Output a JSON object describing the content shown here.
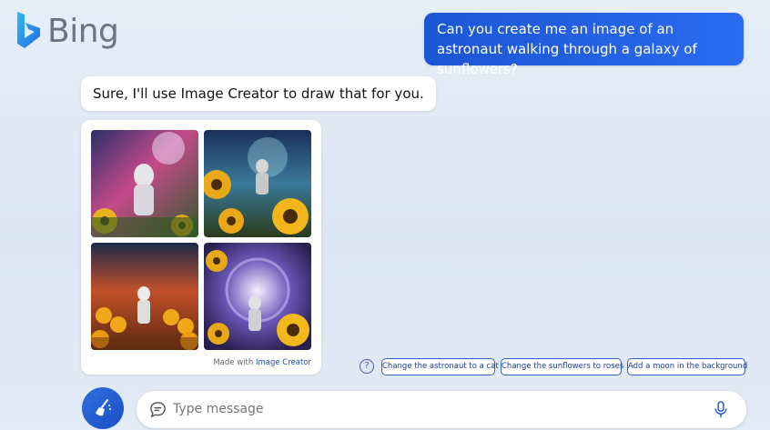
{
  "brand": {
    "name": "Bing"
  },
  "conversation": {
    "user_message": "Can you create me an image of an astronaut walking through a galaxy of sunflowers?",
    "bot_message": "Sure, I'll use Image Creator to draw that for you."
  },
  "image_card": {
    "made_with_prefix": "Made with",
    "made_with_link": "Image Creator",
    "images": [
      {
        "subject": "astronaut-sunflowers-1"
      },
      {
        "subject": "astronaut-sunflowers-2"
      },
      {
        "subject": "astronaut-sunflowers-3"
      },
      {
        "subject": "astronaut-sunflowers-4"
      }
    ]
  },
  "suggestions": [
    "Change the astronaut to a cat",
    "Change the sunflowers to roses",
    "Add a moon in the background"
  ],
  "composer": {
    "placeholder": "Type message",
    "icons": [
      "new-topic-broom-icon",
      "chat-bubble-icon",
      "microphone-icon",
      "help-icon"
    ]
  },
  "colors": {
    "accent": "#1b56d4",
    "background": "#dbe6f3"
  }
}
